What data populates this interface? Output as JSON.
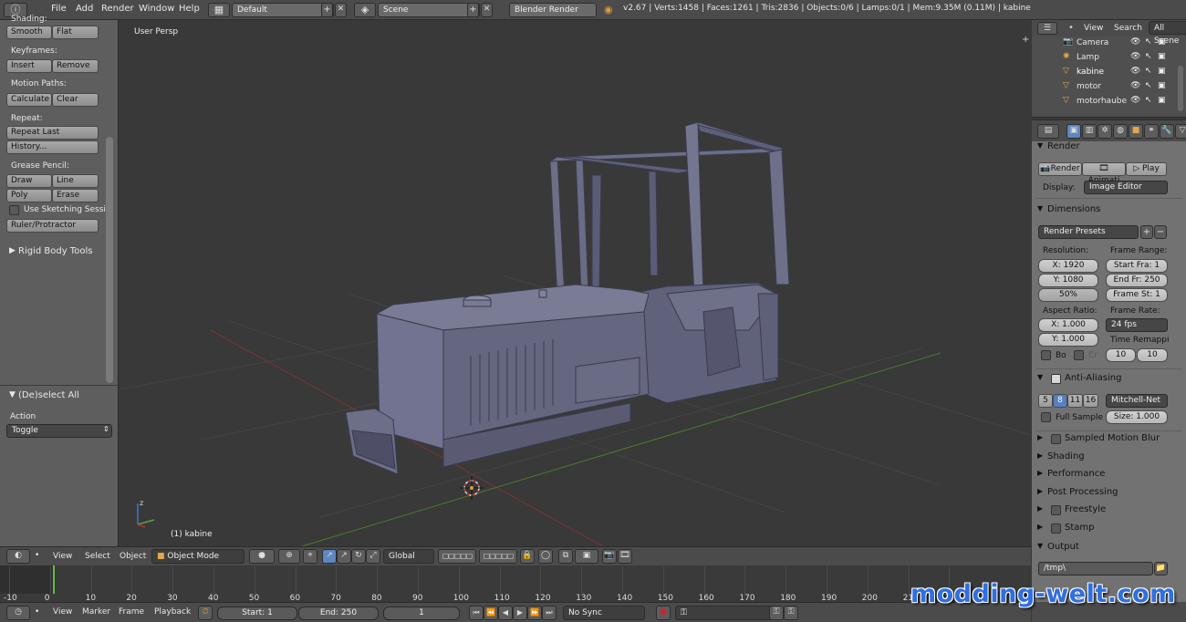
{
  "topbar": {
    "menus": [
      "File",
      "Add",
      "Render",
      "Window",
      "Help"
    ],
    "screen_layout": "Default",
    "scene": "Scene",
    "render_engine": "Blender Render",
    "stats": "v2.67 | Verts:1458 | Faces:1261 | Tris:2836 | Objects:0/6 | Lamps:0/1 | Mem:9.35M (0.11M) | kabine"
  },
  "toolshelf": {
    "shading": {
      "label": "Shading:",
      "smooth": "Smooth",
      "flat": "Flat"
    },
    "keyframes": {
      "label": "Keyframes:",
      "insert": "Insert",
      "remove": "Remove"
    },
    "motion_paths": {
      "label": "Motion Paths:",
      "calculate": "Calculate",
      "clear": "Clear"
    },
    "repeat": {
      "label": "Repeat:",
      "repeat_last": "Repeat Last",
      "history": "History..."
    },
    "grease_pencil": {
      "label": "Grease Pencil:",
      "draw": "Draw",
      "line": "Line",
      "poly": "Poly",
      "erase": "Erase",
      "use_sketching": "Use Sketching Sessi",
      "ruler": "Ruler/Protractor"
    },
    "rigid_body": "Rigid Body Tools",
    "operator": {
      "title": "(De)select All",
      "action_label": "Action",
      "action_value": "Toggle"
    }
  },
  "viewport": {
    "view_name": "User Persp",
    "object_label": "(1) kabine"
  },
  "outliner": {
    "view": "View",
    "search": "Search",
    "scenes": "All Scene",
    "items": [
      "Camera",
      "Lamp",
      "kabine",
      "motor",
      "motorhaube"
    ]
  },
  "properties": {
    "render": {
      "title": "Render",
      "render_btn": "Render",
      "animation_btn": "Animati",
      "play_btn": "Play",
      "display_label": "Display:",
      "display_value": "Image Editor"
    },
    "dimensions": {
      "title": "Dimensions",
      "presets": "Render Presets",
      "resolution_label": "Resolution:",
      "res_x": "X: 1920",
      "res_y": "Y: 1080",
      "res_pct": "50%",
      "frame_range_label": "Frame Range:",
      "start": "Start Fra: 1",
      "end": "End Fr: 250",
      "step": "Frame St: 1",
      "aspect_label": "Aspect Ratio:",
      "aspect_x": "X: 1.000",
      "aspect_y": "Y: 1.000",
      "border": "Bo",
      "crop": "Cr",
      "frame_rate_label": "Frame Rate:",
      "frame_rate": "24 fps",
      "time_remap_label": "Time Remappi",
      "remap_old": "10",
      "remap_new": "10"
    },
    "anti_aliasing": {
      "title": "Anti-Aliasing",
      "samples": [
        "5",
        "8",
        "11",
        "16"
      ],
      "filter": "Mitchell-Net",
      "full_sample": "Full Sample",
      "size": "Size: 1.000"
    },
    "panels": [
      "Sampled Motion Blur",
      "Shading",
      "Performance",
      "Post Processing",
      "Freestyle",
      "Stamp"
    ],
    "output": {
      "title": "Output",
      "path": "/tmp\\"
    }
  },
  "view3d_header": {
    "view": "View",
    "select": "Select",
    "object": "Object",
    "mode": "Object Mode",
    "orientation": "Global"
  },
  "timeline": {
    "ticks": [
      "-10",
      "0",
      "10",
      "20",
      "30",
      "40",
      "50",
      "60",
      "70",
      "80",
      "90",
      "100",
      "110",
      "120",
      "130",
      "140",
      "150",
      "160",
      "170",
      "180",
      "190",
      "200",
      "210",
      "220"
    ],
    "current_frame_marker": "0",
    "view": "View",
    "marker": "Marker",
    "frame": "Frame",
    "playback": "Playback",
    "start": "Start: 1",
    "end": "End: 250",
    "current": "1",
    "sync": "No Sync"
  },
  "watermark": "modding-welt.com"
}
